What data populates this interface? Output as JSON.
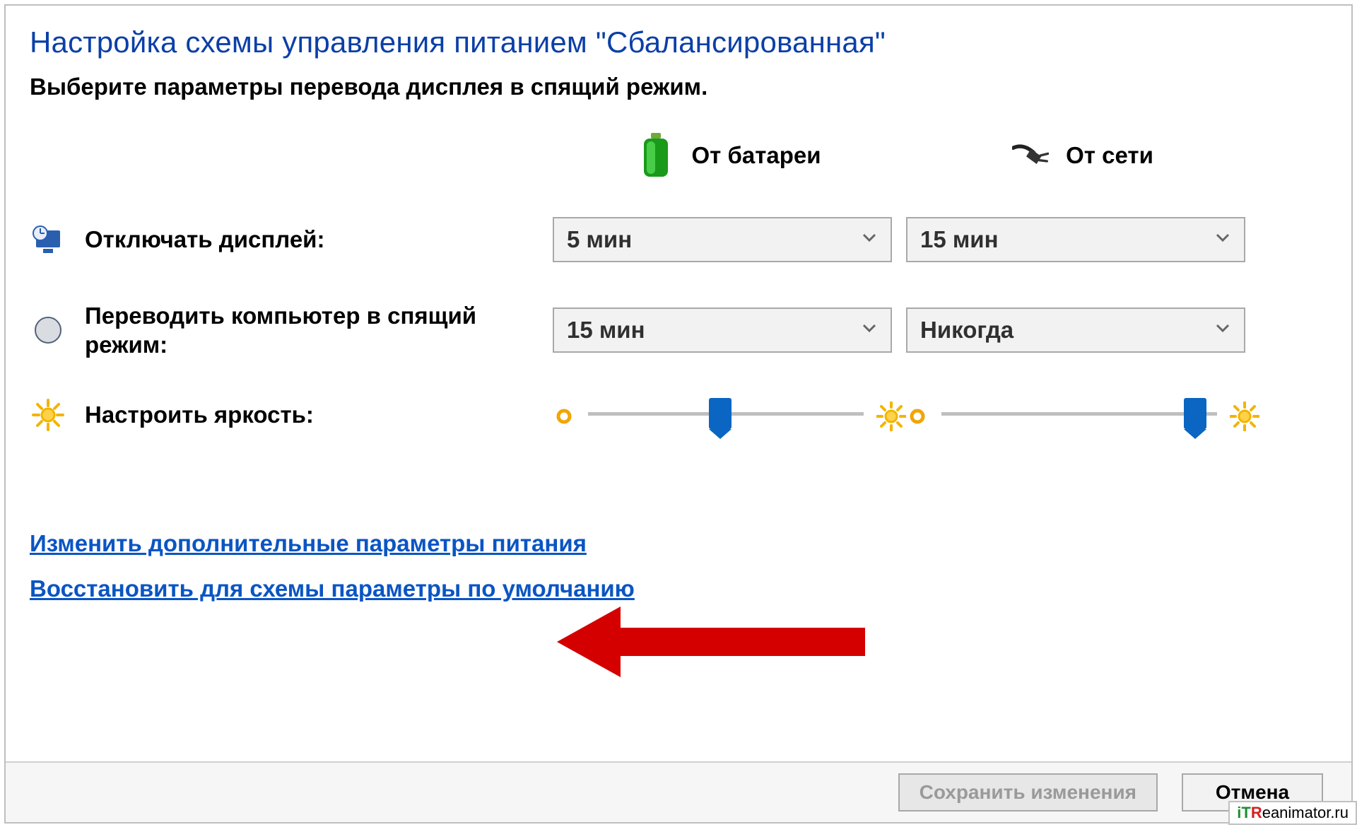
{
  "header": {
    "title": "Настройка схемы управления питанием \"Сбалансированная\"",
    "subtitle": "Выберите параметры перевода дисплея в спящий режим."
  },
  "columns": {
    "battery_label": "От батареи",
    "ac_label": "От сети"
  },
  "rows": {
    "display_off": {
      "label": "Отключать дисплей:",
      "battery_value": "5 мин",
      "ac_value": "15 мин"
    },
    "sleep": {
      "label": "Переводить компьютер в спящий режим:",
      "battery_value": "15 мин",
      "ac_value": "Никогда"
    },
    "brightness": {
      "label": "Настроить яркость:",
      "battery_percent": 48,
      "ac_percent": 92
    }
  },
  "links": {
    "advanced": "Изменить дополнительные параметры питания",
    "restore": "Восстановить для схемы параметры по умолчанию"
  },
  "footer": {
    "save": "Сохранить изменения",
    "cancel": "Отмена"
  },
  "watermark": "iTReanimator.ru"
}
